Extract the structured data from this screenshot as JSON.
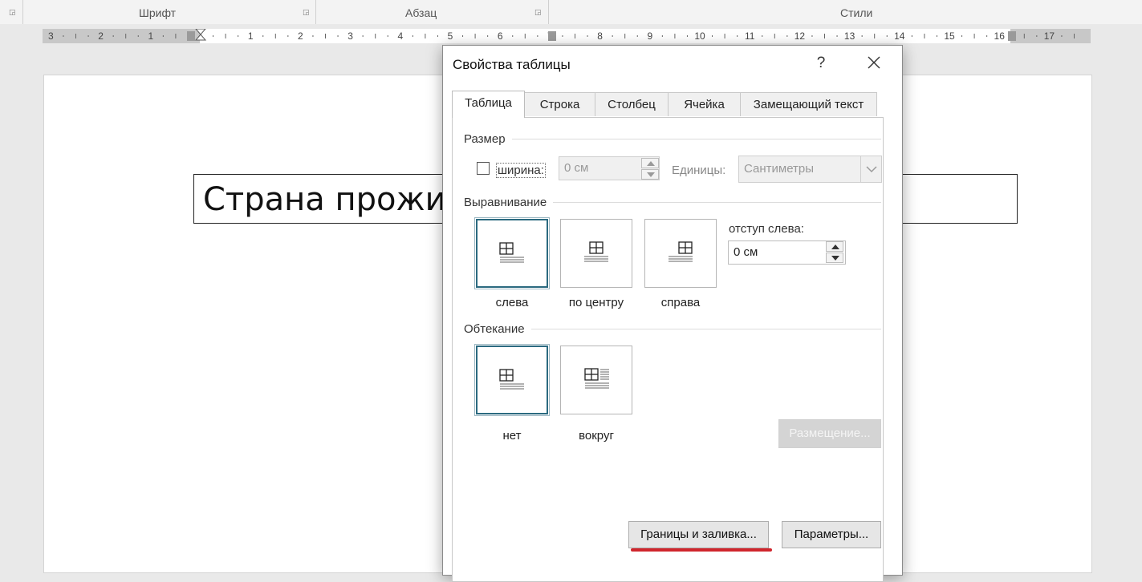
{
  "ribbon": {
    "groups": [
      {
        "label": "Шрифт"
      },
      {
        "label": "Абзац"
      },
      {
        "label": "Стили"
      }
    ]
  },
  "ruler": {
    "left_numbers": [
      "3",
      "2",
      "1"
    ],
    "right_numbers": [
      "1",
      "2",
      "3",
      "4",
      "5",
      "6",
      "7",
      "8",
      "9",
      "10",
      "11",
      "12",
      "13",
      "14",
      "15",
      "16",
      "17"
    ]
  },
  "document": {
    "cell_text": "Страна прожив"
  },
  "dialog": {
    "title": "Свойства таблицы",
    "help": "?",
    "tabs": [
      {
        "label": "Таблица",
        "active": true
      },
      {
        "label": "Строка",
        "active": false
      },
      {
        "label": "Столбец",
        "active": false
      },
      {
        "label": "Ячейка",
        "active": false
      },
      {
        "label": "Замещающий текст",
        "active": false
      }
    ],
    "size": {
      "section_label": "Размер",
      "width_label": "ширина:",
      "width_checked": false,
      "width_value": "0 см",
      "units_label": "Единицы:",
      "units_value": "Сантиметры"
    },
    "alignment": {
      "section_label": "Выравнивание",
      "options": [
        {
          "label": "слева",
          "selected": true
        },
        {
          "label": "по центру",
          "selected": false
        },
        {
          "label": "справа",
          "selected": false
        }
      ],
      "indent_label": "отступ слева:",
      "indent_value": "0 см"
    },
    "wrapping": {
      "section_label": "Обтекание",
      "options": [
        {
          "label": "нет",
          "selected": true
        },
        {
          "label": "вокруг",
          "selected": false
        }
      ],
      "placement_button": "Размещение..."
    },
    "buttons": {
      "borders": "Границы и заливка...",
      "options": "Параметры..."
    }
  },
  "colors": {
    "selected_border": "#2b6a80",
    "annotation_red": "#d0262d"
  }
}
